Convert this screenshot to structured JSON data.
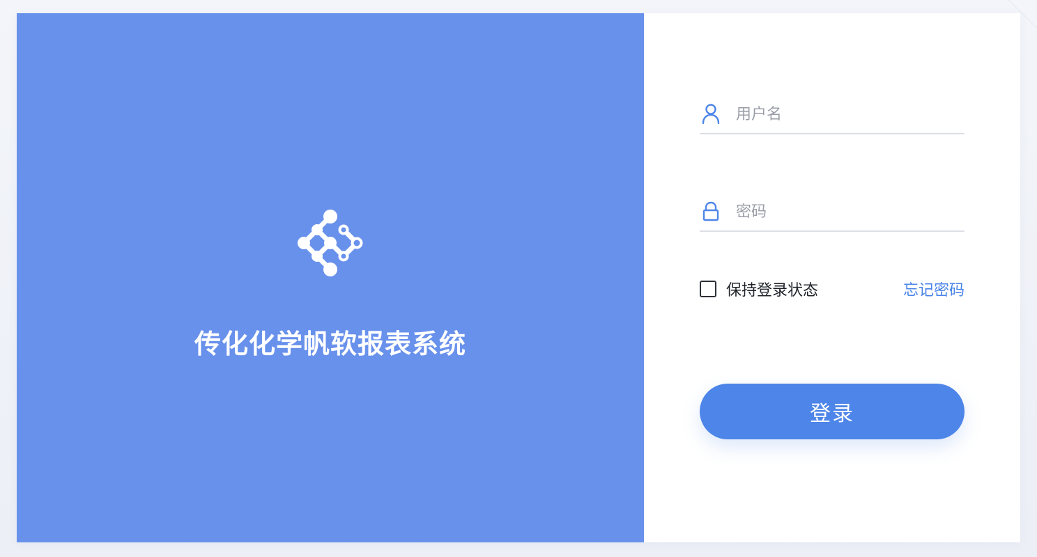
{
  "brand": {
    "title": "传化化学帆软报表系统",
    "logo_icon": "molecule-logo-icon",
    "panel_color": "#6891ec"
  },
  "login_form": {
    "username": {
      "icon": "user-icon",
      "placeholder": "用户名",
      "value": ""
    },
    "password": {
      "icon": "lock-icon",
      "placeholder": "密码",
      "value": ""
    },
    "remember": {
      "label": "保持登录状态",
      "checked": false
    },
    "forgot_password_label": "忘记密码",
    "submit_label": "登录"
  },
  "colors": {
    "accent": "#4d85e9",
    "link": "#4a84e8",
    "input_underline": "#dcdfe6"
  }
}
